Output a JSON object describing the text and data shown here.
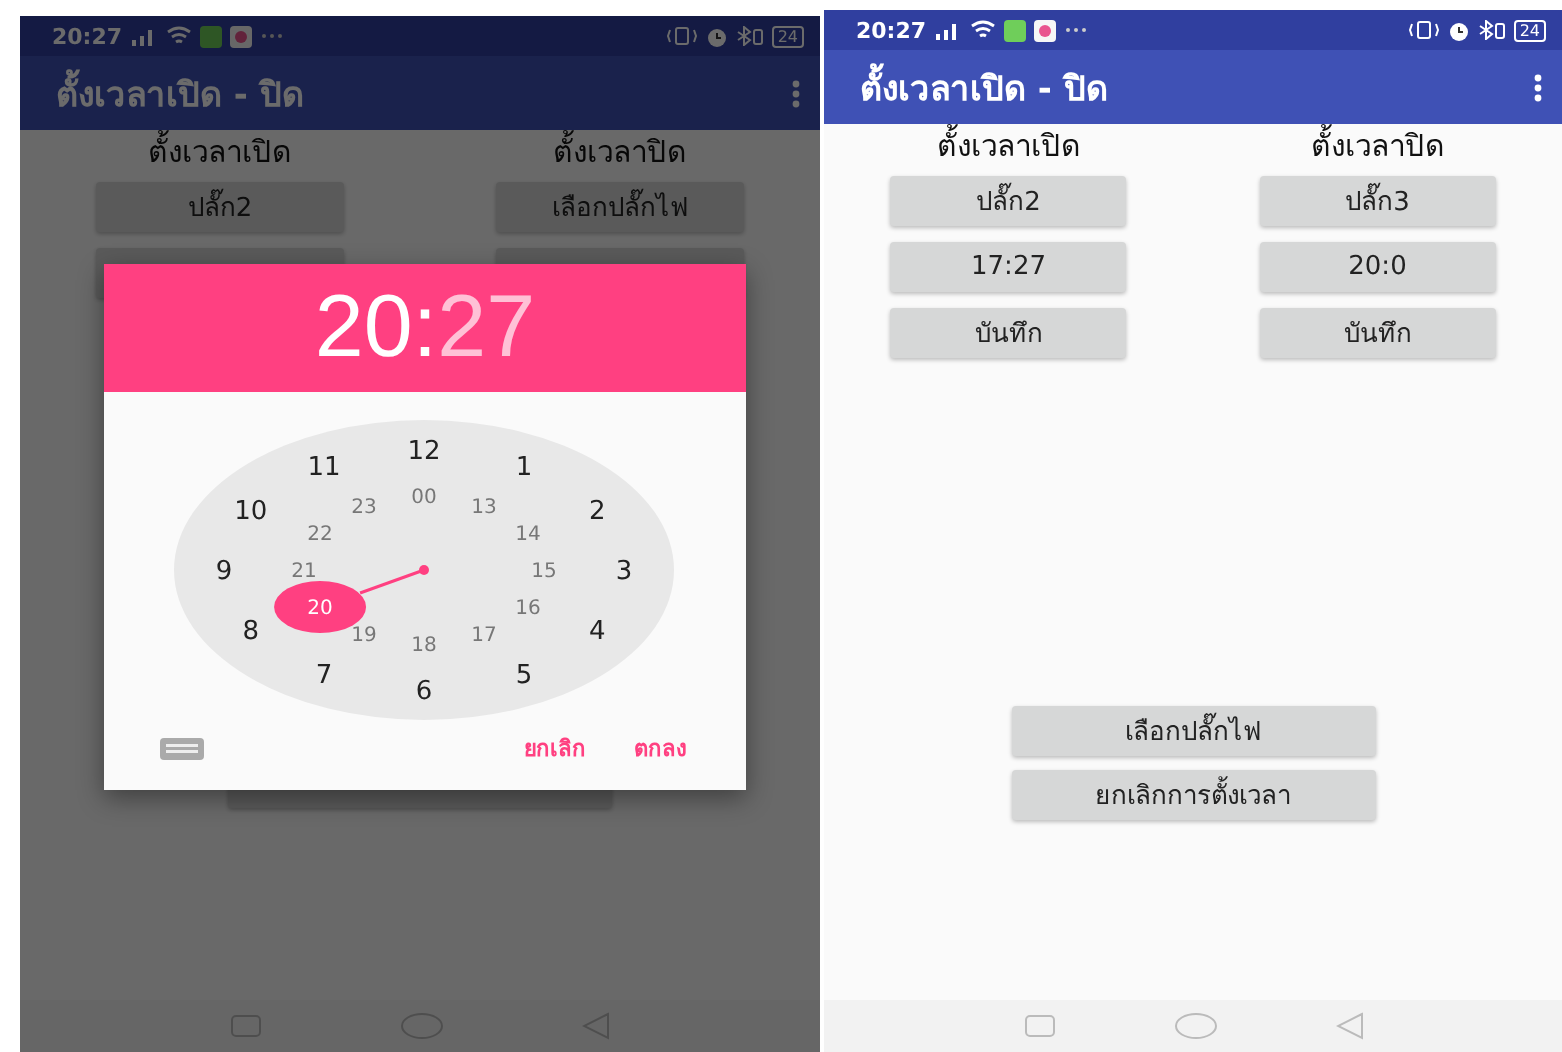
{
  "screens": [
    {
      "status_bar": {
        "time": "20:27",
        "battery": "24"
      },
      "app_bar": {
        "title": "ตั้งเวลาเปิด - ปิด"
      },
      "dimmed": true,
      "columns": [
        {
          "heading": "ตั้งเวลาเปิด",
          "buttons": [
            "ปลั๊ก2"
          ]
        },
        {
          "heading": "ตั้งเวลาปิด",
          "buttons": [
            "เลือกปลั๊กไฟ"
          ]
        }
      ],
      "time_picker": {
        "hour": {
          "text": "20",
          "selected": true
        },
        "separator": ":",
        "minute": {
          "text": "27",
          "selected": false
        },
        "outer_numbers": [
          {
            "label": "12",
            "selected": false
          },
          {
            "label": "1",
            "selected": false
          },
          {
            "label": "2",
            "selected": false
          },
          {
            "label": "3",
            "selected": false
          },
          {
            "label": "4",
            "selected": false
          },
          {
            "label": "5",
            "selected": false
          },
          {
            "label": "6",
            "selected": false
          },
          {
            "label": "7",
            "selected": false
          },
          {
            "label": "8",
            "selected": false
          },
          {
            "label": "9",
            "selected": false
          },
          {
            "label": "10",
            "selected": false
          },
          {
            "label": "11",
            "selected": false
          }
        ],
        "inner_numbers": [
          {
            "label": "00",
            "selected": false
          },
          {
            "label": "13",
            "selected": false
          },
          {
            "label": "14",
            "selected": false
          },
          {
            "label": "15",
            "selected": false
          },
          {
            "label": "16",
            "selected": false
          },
          {
            "label": "17",
            "selected": false
          },
          {
            "label": "18",
            "selected": false
          },
          {
            "label": "19",
            "selected": false
          },
          {
            "label": "20",
            "selected": true
          },
          {
            "label": "21",
            "selected": false
          },
          {
            "label": "22",
            "selected": false
          },
          {
            "label": "23",
            "selected": false
          }
        ],
        "buttons": [
          "ยกเลิก",
          "ตกลง"
        ]
      }
    },
    {
      "status_bar": {
        "time": "20:27",
        "battery": "24"
      },
      "app_bar": {
        "title": "ตั้งเวลาเปิด - ปิด"
      },
      "dimmed": false,
      "columns": [
        {
          "heading": "ตั้งเวลาเปิด",
          "buttons": [
            "ปลั๊ก2",
            "17:27",
            "บันทึก"
          ]
        },
        {
          "heading": "ตั้งเวลาปิด",
          "buttons": [
            "ปลั๊ก3",
            "20:0",
            "บันทึก"
          ]
        }
      ],
      "bottom_buttons": [
        "เลือกปลั๊กไฟ",
        "ยกเลิกการตั้งเวลา"
      ]
    }
  ]
}
